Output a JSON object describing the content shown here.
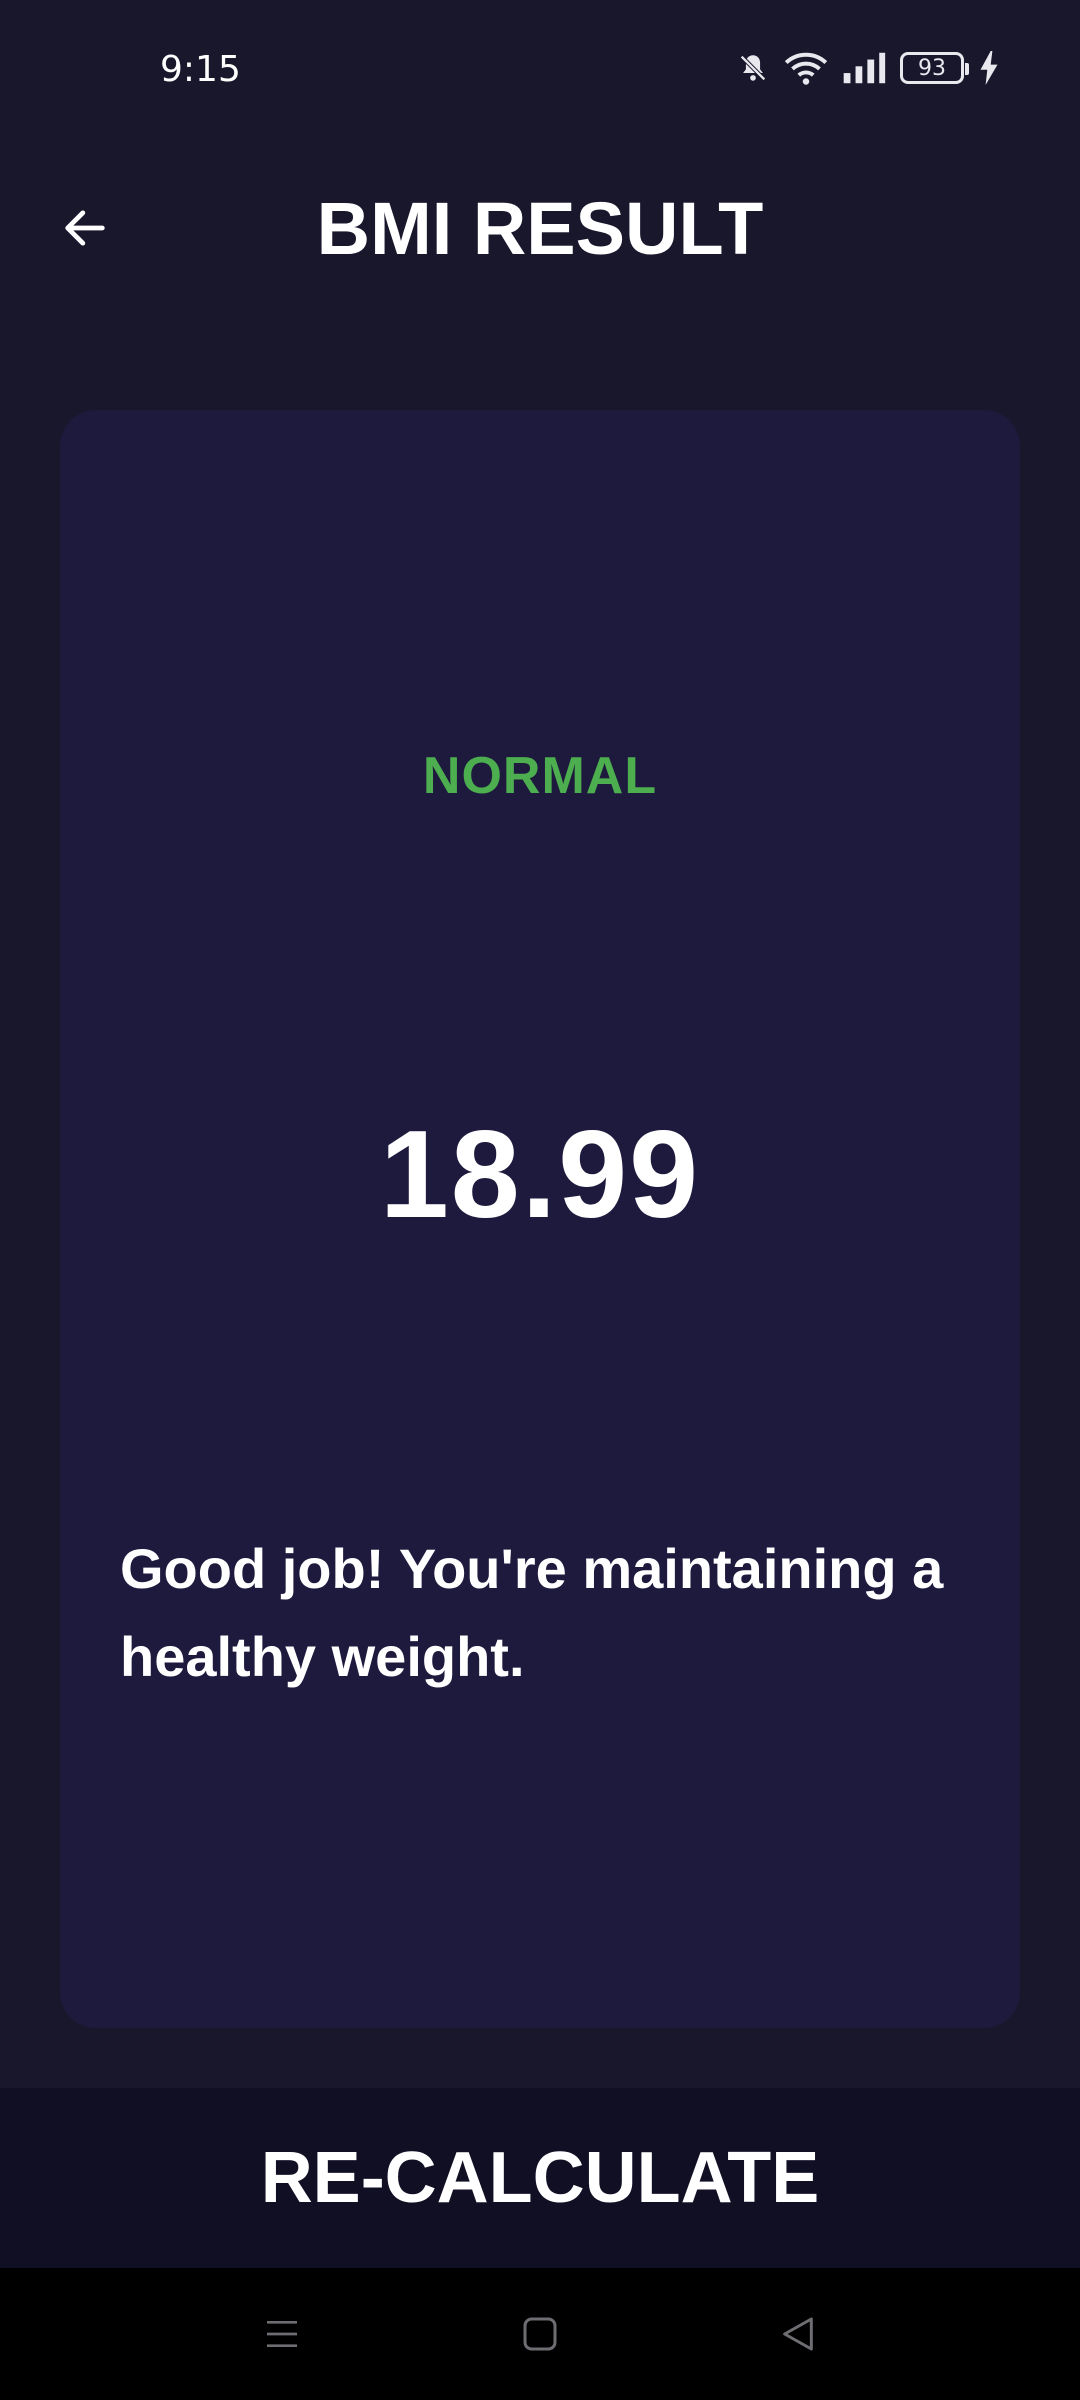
{
  "status_bar": {
    "time": "9:15",
    "battery_level": "93",
    "icons": [
      "bell-off-icon",
      "wifi-icon",
      "signal-icon",
      "battery-icon",
      "charging-bolt-icon"
    ]
  },
  "app_bar": {
    "title": "BMI RESULT",
    "back_icon": "arrow-left-icon"
  },
  "result": {
    "category": "NORMAL",
    "category_color": "#4cae4f",
    "bmi": "18.99",
    "message": "Good job! You're maintaining a healthy weight."
  },
  "actions": {
    "recalculate_label": "RE-CALCULATE"
  },
  "nav_bar": {
    "icons": [
      "menu-icon",
      "home-icon",
      "back-triangle-icon"
    ]
  },
  "colors": {
    "background": "#19172c",
    "card": "#1e1a3d",
    "button": "#110f24"
  }
}
